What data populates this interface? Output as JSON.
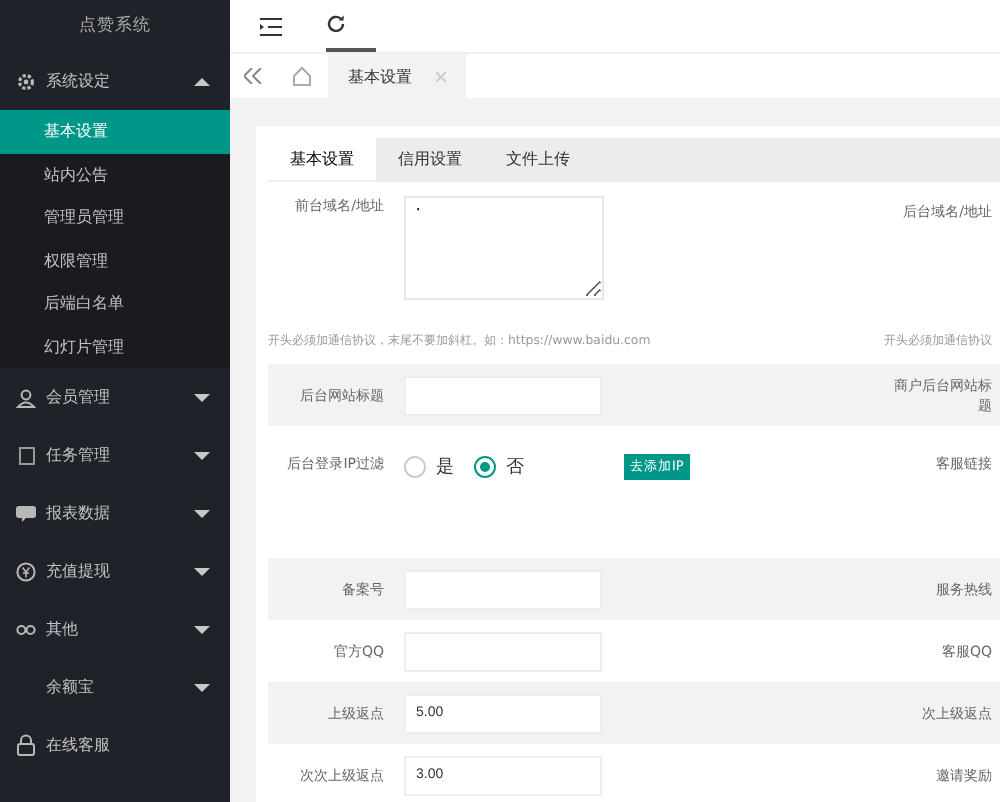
{
  "sidebar": {
    "title": "点赞系统",
    "groups": [
      {
        "label": "系统设定",
        "kind": "menu",
        "expanded": true,
        "items": [
          {
            "label": "基本设置",
            "selected": true
          },
          {
            "label": "站内公告",
            "selected": false
          },
          {
            "label": "管理员管理",
            "selected": false
          },
          {
            "label": "权限管理",
            "selected": false
          },
          {
            "label": "后端白名单",
            "selected": false
          },
          {
            "label": "幻灯片管理",
            "selected": false
          }
        ]
      },
      {
        "label": "会员管理",
        "kind": "menu",
        "expanded": false
      },
      {
        "label": "任务管理",
        "kind": "menu",
        "expanded": false
      },
      {
        "label": "报表数据",
        "kind": "menu",
        "expanded": false
      },
      {
        "label": "充值提现",
        "kind": "menu",
        "expanded": false
      },
      {
        "label": "其他",
        "kind": "menu",
        "expanded": false
      },
      {
        "label": "余额宝",
        "kind": "menu",
        "expanded": false
      },
      {
        "label": "在线客服",
        "kind": "link"
      }
    ]
  },
  "page_tabs": [
    {
      "label": "基本设置",
      "selected": true
    }
  ],
  "form_tabs": [
    {
      "label": "基本设置",
      "selected": true
    },
    {
      "label": "信用设置",
      "selected": false
    },
    {
      "label": "文件上传",
      "selected": false
    }
  ],
  "rows": [
    {
      "kind": "textarea",
      "shaded": false,
      "label": "前台域名/地址",
      "value": "·",
      "right_label": "后台域名/地址"
    },
    {
      "kind": "hint",
      "shaded": false,
      "text": "开头必须加通信协议，末尾不要加斜杠。如：https://www.baidu.com",
      "right_text": "开头必须加通信协议"
    },
    {
      "kind": "input",
      "shaded": true,
      "label": "后台网站标题",
      "value": "",
      "right_label": "商户后台网站标题"
    },
    {
      "kind": "radio",
      "shaded": false,
      "label": "后台登录IP过滤",
      "options": [
        {
          "label": "是",
          "selected": false
        },
        {
          "label": "否",
          "selected": true
        }
      ],
      "action": "去添加IP",
      "right_label": "客服链接"
    },
    {
      "kind": "input",
      "shaded": true,
      "label": "备案号",
      "value": "",
      "right_label": "服务热线"
    },
    {
      "kind": "input",
      "shaded": false,
      "label": "官方QQ",
      "value": "",
      "right_label": "客服QQ"
    },
    {
      "kind": "input",
      "shaded": true,
      "label": "上级返点",
      "value": "5.00",
      "right_label": "次上级返点"
    },
    {
      "kind": "input",
      "shaded": false,
      "label": "次次上级返点",
      "value": "3.00",
      "right_label": "邀请奖励"
    }
  ]
}
